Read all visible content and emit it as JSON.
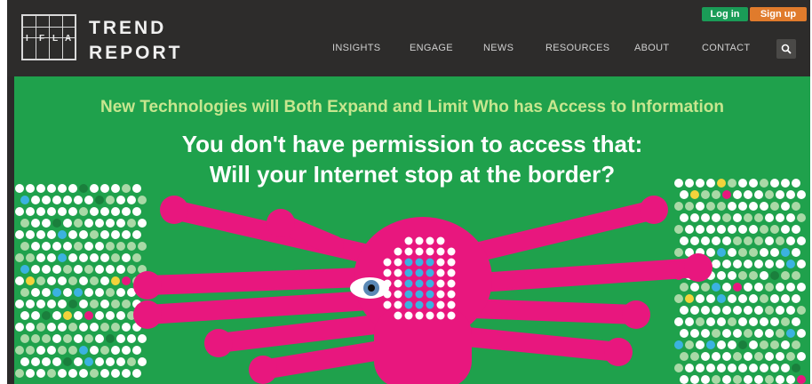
{
  "logo": {
    "letters": [
      "I",
      "F",
      "L",
      "A"
    ],
    "brand_line1": "TREND",
    "brand_line2": "REPORT"
  },
  "auth": {
    "login_label": "Log in",
    "signup_label": "Sign up"
  },
  "nav": {
    "items": [
      {
        "label": "INSIGHTS"
      },
      {
        "label": "ENGAGE"
      },
      {
        "label": "NEWS"
      },
      {
        "label": "RESOURCES"
      },
      {
        "label": "ABOUT"
      },
      {
        "label": "CONTACT"
      }
    ],
    "search_icon": "search-icon"
  },
  "hero": {
    "subtitle": "New Technologies will Both Expand and Limit Who has Access to Information",
    "title_line1": "You don't have permission to access that:",
    "title_line2": "Will your Internet stop at the border?"
  },
  "colors": {
    "header_bg": "#2d2c2b",
    "hero_bg": "#1fa14c",
    "login": "#1a9c57",
    "signup": "#e07b2c",
    "subtitle": "#c7e68f",
    "figure": "#e8177e"
  }
}
